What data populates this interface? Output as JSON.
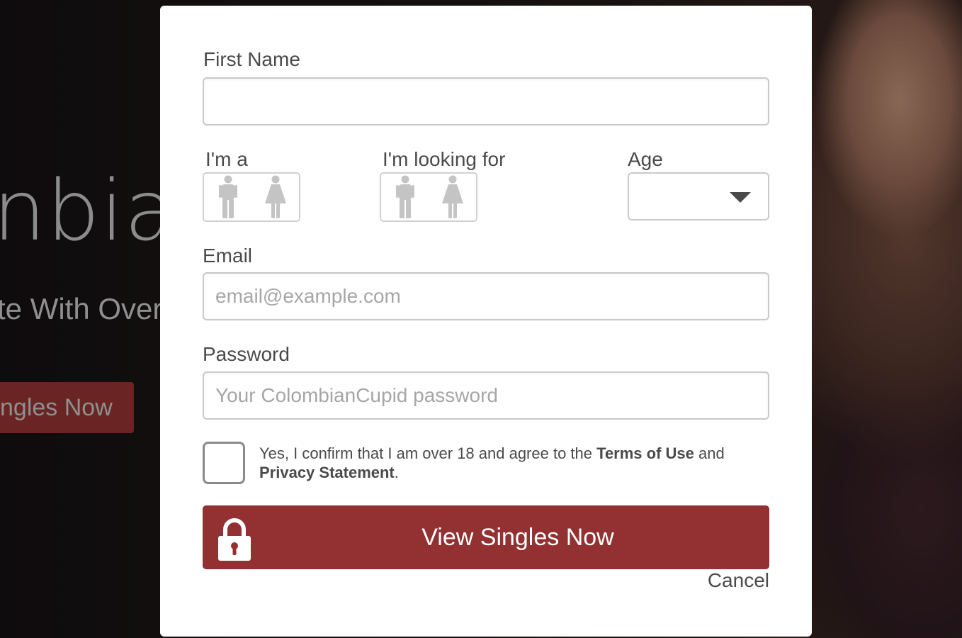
{
  "background": {
    "headline_fragment": "nbian",
    "subline_fragment": "te With Over",
    "cta_fragment": "ngles Now"
  },
  "form": {
    "first_name": {
      "label": "First Name",
      "value": "",
      "placeholder": ""
    },
    "gender": {
      "label": "I'm a",
      "options": [
        {
          "name": "male",
          "icon": "male-icon"
        },
        {
          "name": "female",
          "icon": "female-icon"
        }
      ]
    },
    "seeking": {
      "label": "I'm looking for",
      "options": [
        {
          "name": "male",
          "icon": "male-icon"
        },
        {
          "name": "female",
          "icon": "female-icon"
        }
      ]
    },
    "age": {
      "label": "Age",
      "selected": ""
    },
    "email": {
      "label": "Email",
      "value": "",
      "placeholder": "email@example.com"
    },
    "password": {
      "label": "Password",
      "value": "",
      "placeholder": "Your ColombianCupid password"
    },
    "consent": {
      "checked": false,
      "text_prefix": "Yes, I confirm that I am over 18 and agree to the ",
      "terms_link": "Terms of Use",
      "text_middle": " and ",
      "privacy_link": "Privacy Statement",
      "text_suffix": "."
    },
    "submit_label": "View Singles Now",
    "cancel_label": "Cancel"
  },
  "colors": {
    "primary": "#923032",
    "border": "#c9c9c9",
    "icon_gray": "#c4c4c4",
    "text": "#4a4a4a"
  }
}
